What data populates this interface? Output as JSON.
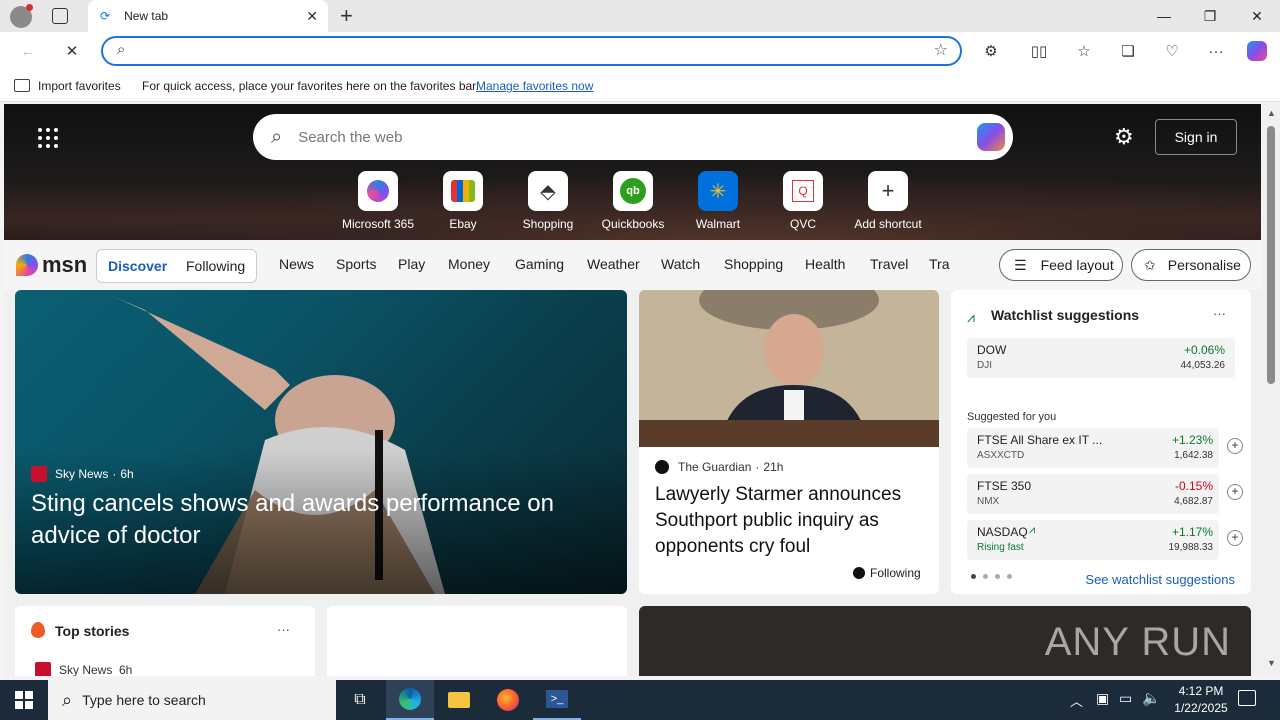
{
  "browser": {
    "tab_title": "New tab",
    "new_tab_symbol": "+",
    "favbar_import": "Import favorites",
    "favbar_message": "For quick access, place your favorites here on the favorites bar.",
    "favbar_link": "Manage favorites now"
  },
  "newtab": {
    "search_placeholder": "Search the web",
    "sign_in": "Sign in",
    "shortcuts": [
      {
        "label": "Microsoft 365",
        "icon": "m365-icon"
      },
      {
        "label": "Ebay",
        "icon": "ebay-icon"
      },
      {
        "label": "Shopping",
        "icon": "tag-icon"
      },
      {
        "label": "Quickbooks",
        "icon": "quickbooks-icon"
      },
      {
        "label": "Walmart",
        "icon": "walmart-icon"
      },
      {
        "label": "QVC",
        "icon": "qvc-icon"
      },
      {
        "label": "Add shortcut",
        "icon": "plus-icon"
      }
    ]
  },
  "nav": {
    "brand": "msn",
    "discover": "Discover",
    "following": "Following",
    "links": [
      "News",
      "Sports",
      "Play",
      "Money",
      "Gaming",
      "Weather",
      "Watch",
      "Shopping",
      "Health",
      "Travel",
      "Tra"
    ],
    "feed_layout": "Feed layout",
    "personalise": "Personalise"
  },
  "main_story": {
    "source": "Sky News",
    "age": "6h",
    "headline": "Sting cancels shows and awards performance on advice of doctor"
  },
  "guardian_story": {
    "source": "The Guardian",
    "age": "21h",
    "headline": "Lawyerly Starmer announces Southport public inquiry as opponents cry foul",
    "following": "Following"
  },
  "watchlist": {
    "title": "Watchlist suggestions",
    "more": "···",
    "dow": {
      "name": "DOW",
      "sub": "DJI",
      "change": "+0.06%",
      "value": "44,053.26"
    },
    "suggested_label": "Suggested for you",
    "items": [
      {
        "name": "FTSE All Share ex IT ...",
        "sub": "ASXXCTD",
        "change": "+1.23%",
        "value": "1,642.38"
      },
      {
        "name": "FTSE 350",
        "sub": "NMX",
        "change": "-0.15%",
        "value": "4,682.87"
      },
      {
        "name": "NASDAQ",
        "sub": "Rising fast",
        "change": "+1.17%",
        "value": "19,988.33"
      }
    ],
    "see_more": "See watchlist suggestions",
    "colors": {
      "up": "#0a7a2f",
      "down": "#d0021b"
    }
  },
  "top_stories": {
    "title": "Top stories",
    "more": "···",
    "first_source": "Sky News",
    "first_age": "6h"
  },
  "watermark": "ANY RUN",
  "taskbar": {
    "search_placeholder": "Type here to search",
    "time": "4:12 PM",
    "date": "1/22/2025"
  }
}
